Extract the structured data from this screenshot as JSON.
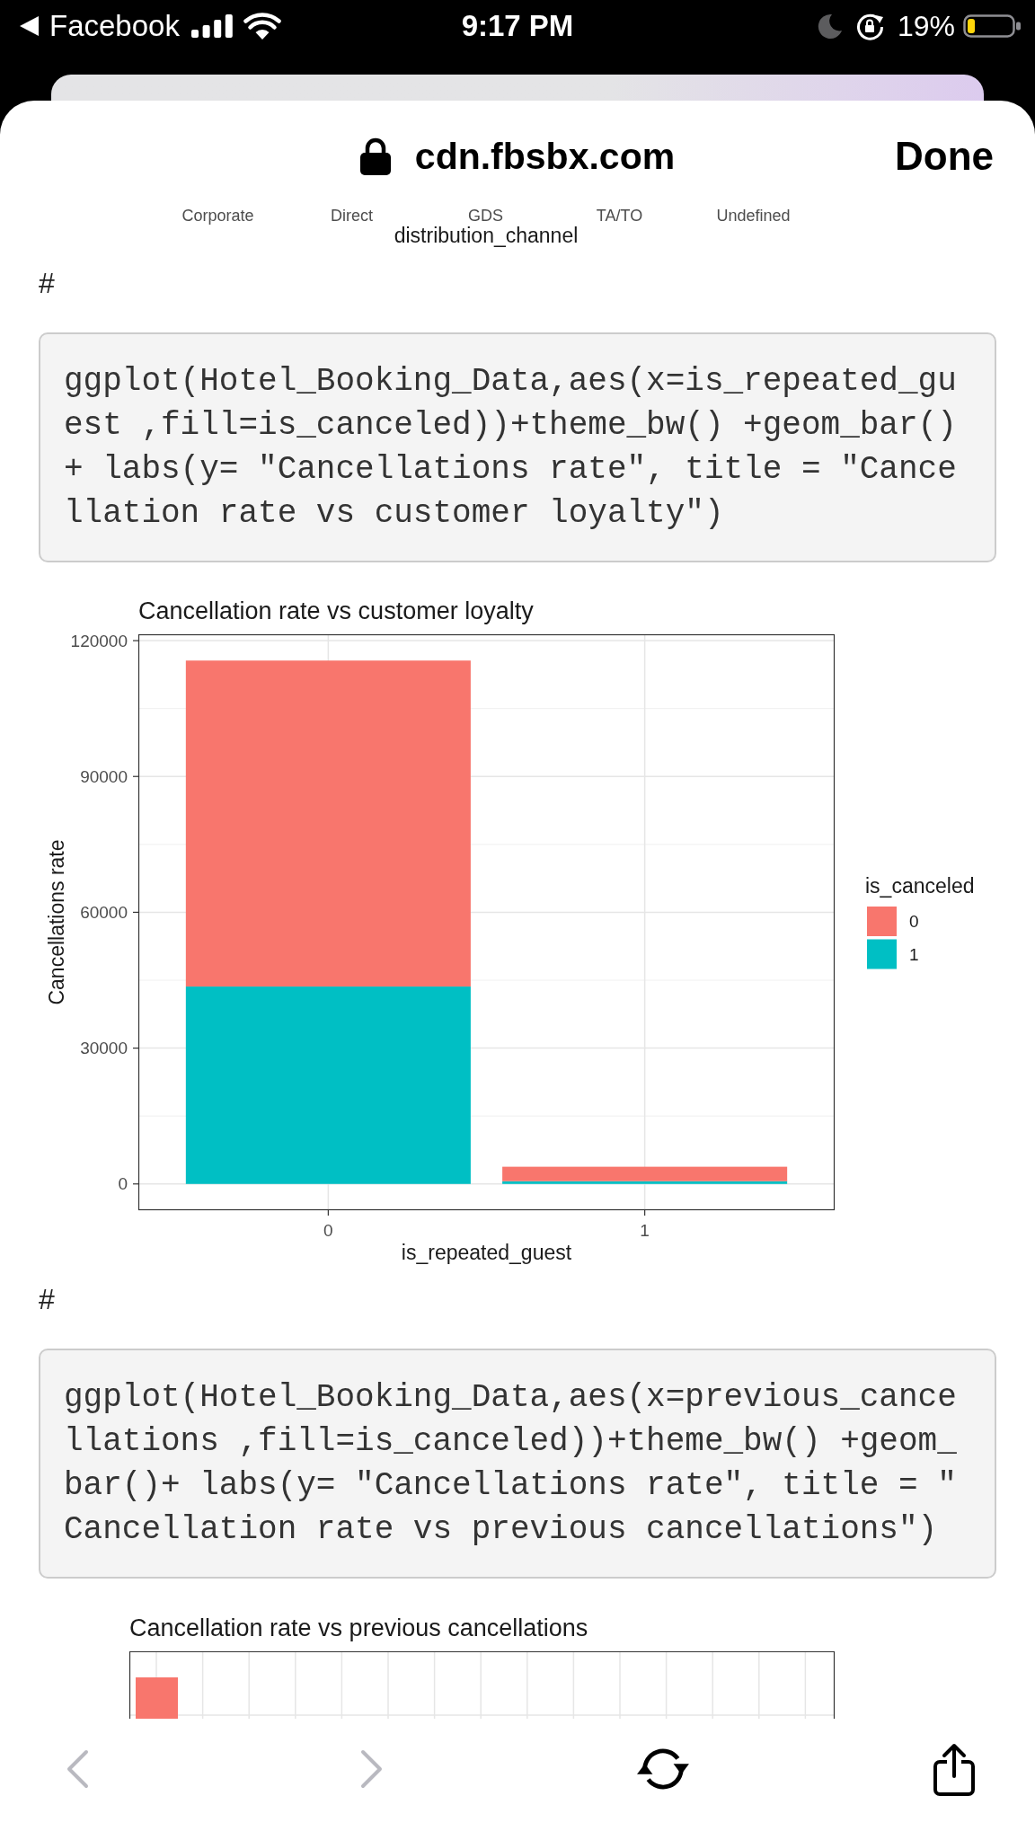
{
  "status_bar": {
    "back_label": "Facebook",
    "time": "9:17 PM",
    "battery": "19%"
  },
  "browser_header": {
    "url": "cdn.fbsbx.com",
    "done": "Done"
  },
  "content": [
    {
      "kind": "axis_fragment",
      "x_tick_labels": [
        "Corporate",
        "Direct",
        "GDS",
        "TA/TO",
        "Undefined"
      ],
      "xlabel": "distribution_channel"
    },
    {
      "kind": "heading",
      "text": "#"
    },
    {
      "kind": "code",
      "lines": [
        "ggplot(Hotel_Booking_Data,aes(x=is_repeated_gu",
        "est ,fill=is_canceled))+theme_bw() +geom_bar()",
        "+ labs(y= \"Cancellations rate\", title = \"Cance",
        "llation rate vs customer loyalty\")"
      ]
    },
    {
      "kind": "chart",
      "chart_data": {
        "type": "bar",
        "title": "Cancellation rate vs customer loyalty",
        "xlabel": "is_repeated_guest",
        "ylabel": "Cancellations rate",
        "categories": [
          "0",
          "1"
        ],
        "series": [
          {
            "name": "0",
            "color": "#f8766d",
            "values": [
              72000,
              3200
            ]
          },
          {
            "name": "1",
            "color": "#00bfc4",
            "values": [
              43600,
              600
            ]
          }
        ],
        "stacked": true,
        "ylim": [
          -5800,
          121400
        ],
        "yticks": [
          0,
          30000,
          60000,
          90000,
          120000
        ],
        "grid": true,
        "legend": {
          "title": "is_canceled"
        }
      }
    },
    {
      "kind": "heading",
      "text": "#"
    },
    {
      "kind": "code",
      "lines": [
        "ggplot(Hotel_Booking_Data,aes(x=previous_cance",
        "llations ,fill=is_canceled))+theme_bw() +geom_",
        "bar()+ labs(y= \"Cancellations rate\", title = \"",
        "Cancellation rate vs previous cancellations\")"
      ]
    },
    {
      "kind": "chart_cropped",
      "title": "Cancellation rate vs previous cancellations"
    }
  ],
  "toolbar": [
    {
      "kind": "back",
      "disabled": true
    },
    {
      "kind": "forward",
      "disabled": true
    },
    {
      "kind": "reload",
      "disabled": false
    },
    {
      "kind": "share",
      "disabled": false
    }
  ]
}
